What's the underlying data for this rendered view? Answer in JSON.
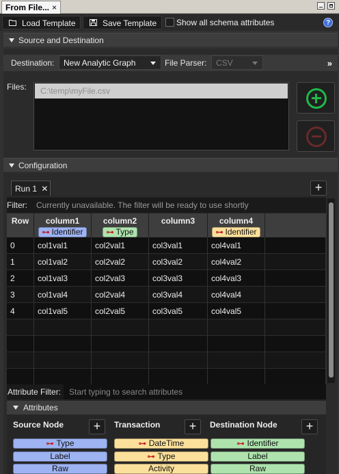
{
  "view_tab": {
    "title": "From File...",
    "close": "×"
  },
  "toolbar": {
    "load_template": "Load Template",
    "save_template": "Save Template",
    "show_all_label": "Show all schema attributes",
    "help": "?"
  },
  "source_destination": {
    "header": "Source and Destination",
    "destination_label": "Destination:",
    "destination_value": "New Analytic Graph",
    "file_parser_label": "File Parser:",
    "file_parser_value": "CSV",
    "more": "»",
    "files_label": "Files:",
    "files": [
      "C:\\temp\\myFile.csv"
    ]
  },
  "configuration": {
    "header": "Configuration",
    "run_tab": "Run 1",
    "run_tab_close": "✕",
    "add": "+",
    "filter_label": "Filter:",
    "filter_text": "Currently unavailable. The filter will be ready to use shortly",
    "table": {
      "row_header": "Row",
      "columns": [
        {
          "name": "column1",
          "attr": "Identifier",
          "key": true,
          "color": "#9db3f2"
        },
        {
          "name": "column2",
          "attr": "Type",
          "key": true,
          "color": "#aee3ae"
        },
        {
          "name": "column3",
          "attr": "",
          "key": false,
          "color": ""
        },
        {
          "name": "column4",
          "attr": "Identifier",
          "key": true,
          "color": "#fbe09b"
        }
      ],
      "rows": [
        [
          "0",
          "col1val1",
          "col2val1",
          "col3val1",
          "col4val1"
        ],
        [
          "1",
          "col1val2",
          "col2val2",
          "col3val2",
          "col4val2"
        ],
        [
          "2",
          "col1val3",
          "col2val3",
          "col3val3",
          "col4val3"
        ],
        [
          "3",
          "col1val4",
          "col2val4",
          "col3val4",
          "col4val4"
        ],
        [
          "4",
          "col1val5",
          "col2val5",
          "col3val5",
          "col4val5"
        ]
      ]
    },
    "attribute_filter_label": "Attribute Filter:",
    "attribute_filter_placeholder": "Start typing to search attributes",
    "attributes_header": "Attributes",
    "attribute_groups": [
      {
        "title": "Source Node",
        "color": "#9db3f2",
        "items": [
          {
            "label": "Type",
            "key": true
          },
          {
            "label": "Label",
            "key": false
          },
          {
            "label": "Raw",
            "key": false
          }
        ]
      },
      {
        "title": "Transaction",
        "color": "#fbe09b",
        "items": [
          {
            "label": "DateTime",
            "key": true
          },
          {
            "label": "Type",
            "key": true
          },
          {
            "label": "Activity",
            "key": false
          }
        ]
      },
      {
        "title": "Destination Node",
        "color": "#aee3ae",
        "items": [
          {
            "label": "Identifier",
            "key": true
          },
          {
            "label": "Label",
            "key": false
          },
          {
            "label": "Raw",
            "key": false
          }
        ]
      }
    ]
  }
}
